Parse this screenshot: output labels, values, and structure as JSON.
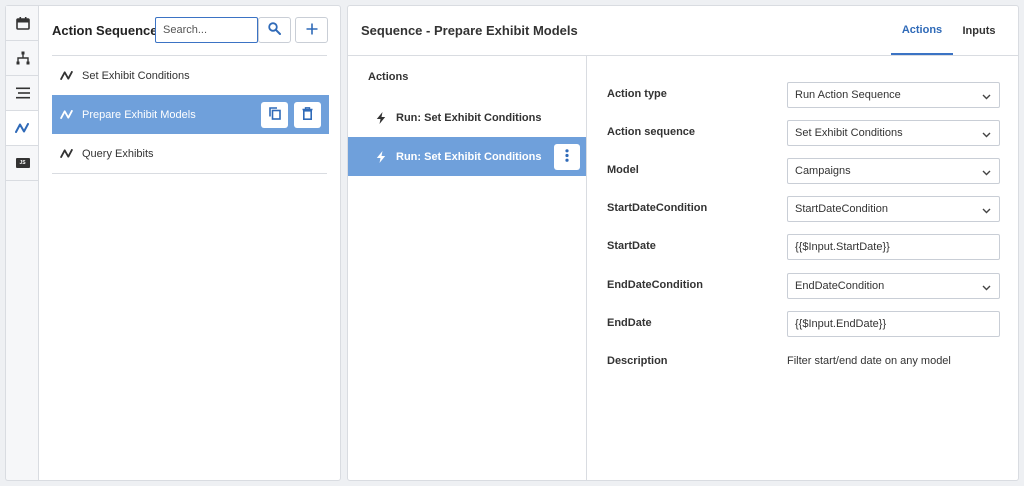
{
  "rail": {
    "items": [
      {
        "name": "calendar-icon",
        "active": false
      },
      {
        "name": "hierarchy-icon",
        "active": false
      },
      {
        "name": "list-icon",
        "active": false
      },
      {
        "name": "sequence-icon",
        "active": true
      },
      {
        "name": "js-icon",
        "active": false,
        "label": "JS"
      }
    ]
  },
  "left": {
    "title": "Action Sequences",
    "search_placeholder": "Search...",
    "items": [
      {
        "label": "Set Exhibit Conditions",
        "selected": false
      },
      {
        "label": "Prepare Exhibit Models",
        "selected": true
      },
      {
        "label": "Query Exhibits",
        "selected": false
      }
    ]
  },
  "right": {
    "title": "Sequence - Prepare Exhibit Models",
    "tabs": [
      {
        "label": "Actions",
        "active": true
      },
      {
        "label": "Inputs",
        "active": false
      }
    ],
    "actions_heading": "Actions",
    "actions": [
      {
        "label": "Run: Set Exhibit Conditions",
        "selected": false
      },
      {
        "label": "Run: Set Exhibit Conditions",
        "selected": true
      }
    ],
    "form": {
      "action_type": {
        "label": "Action type",
        "value": "Run Action Sequence"
      },
      "action_sequence": {
        "label": "Action sequence",
        "value": "Set Exhibit Conditions"
      },
      "model": {
        "label": "Model",
        "value": "Campaigns"
      },
      "start_date_condition": {
        "label": "StartDateCondition",
        "value": "StartDateCondition"
      },
      "start_date": {
        "label": "StartDate",
        "value": "{{$Input.StartDate}}"
      },
      "end_date_condition": {
        "label": "EndDateCondition",
        "value": "EndDateCondition"
      },
      "end_date": {
        "label": "EndDate",
        "value": "{{$Input.EndDate}}"
      },
      "description": {
        "label": "Description",
        "value": "Filter start/end date on any model"
      }
    }
  },
  "colors": {
    "accent": "#3b73c4",
    "selected_bg": "#6fa0db"
  }
}
